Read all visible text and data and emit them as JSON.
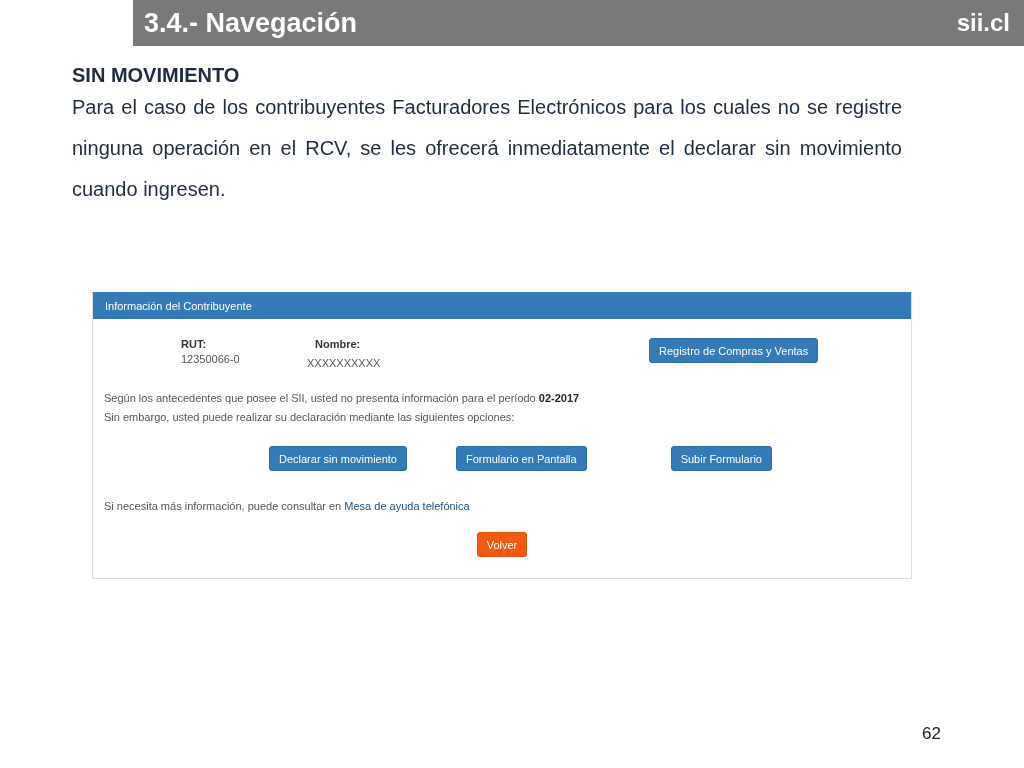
{
  "slide": {
    "title": "3.4.- Navegación",
    "brand": "sii.cl",
    "heading": "SIN MOVIMIENTO",
    "paragraph": "Para el caso de los contribuyentes Facturadores Electrónicos para los cuales no se registre ninguna operación en el RCV, se les ofrecerá inmediatamente el declarar sin movimiento cuando ingresen.",
    "page_number": "62"
  },
  "panel": {
    "title": "Información del Contribuyente",
    "fields": [
      {
        "label": "RUT:",
        "value": "12350066-0"
      },
      {
        "label": "Nombre:",
        "value": "XXXXXXXXXX"
      }
    ],
    "top_button": "Registro de Compras y Ventas",
    "messages": [
      "Según los antecedentes que posee el SII, usted no presenta información para el período **02-2017**",
      "Sin embargo, usted puede realizar su declaración mediante las siguientes opciones:"
    ],
    "options": [
      "Declarar sin movimiento",
      "Formulario en Pantalla",
      "Subir Formulario"
    ],
    "help_text": "Si necesita más información, puede consultar en",
    "help_link": "Mesa de ayuda telefónica",
    "back_button": "Volver"
  }
}
